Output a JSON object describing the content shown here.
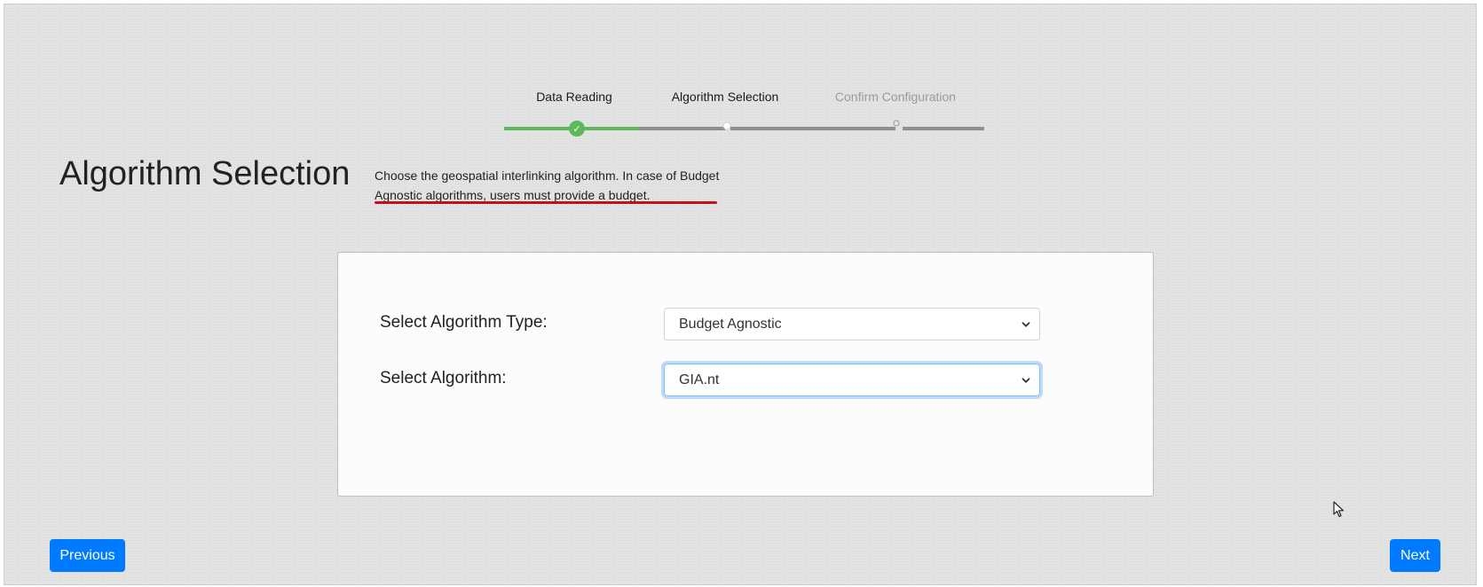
{
  "stepper": {
    "steps": [
      {
        "label": "Data Reading",
        "state": "done"
      },
      {
        "label": "Algorithm Selection",
        "state": "active"
      },
      {
        "label": "Confirm Configuration",
        "state": "pending"
      }
    ],
    "check_glyph": "✓"
  },
  "header": {
    "title": "Algorithm Selection",
    "description": "Choose the geospatial interlinking algorithm. In case of Budget Agnostic algorithms, users must provide a budget."
  },
  "form": {
    "algorithm_type": {
      "label": "Select Algorithm Type:",
      "value": "Budget Agnostic"
    },
    "algorithm": {
      "label": "Select Algorithm:",
      "value": "GIA.nt"
    }
  },
  "navigation": {
    "previous_label": "Previous",
    "next_label": "Next"
  },
  "colors": {
    "primary_button": "#007bff",
    "step_done": "#5cb85c",
    "step_todo": "#8f8f8f",
    "annotation_underline": "#c4101c"
  },
  "icons": {
    "step_done": "check-icon",
    "select_dropdown": "chevron-down-icon",
    "pointer": "mouse-cursor-icon"
  }
}
